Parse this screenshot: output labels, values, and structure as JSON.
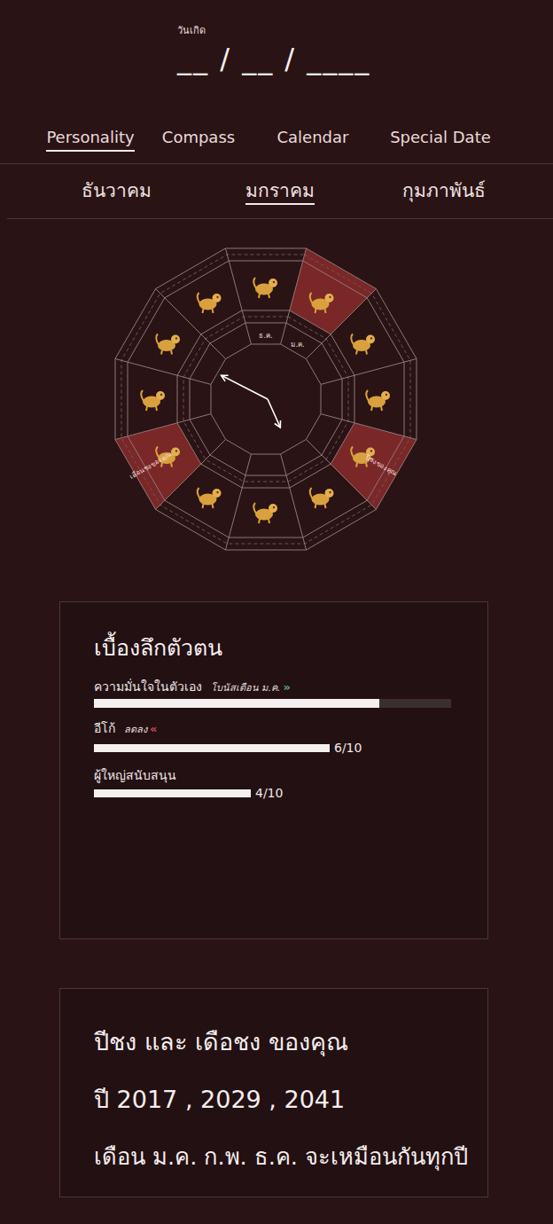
{
  "birthdate": {
    "label": "วันเกิด",
    "placeholder": "__ / __ / ____"
  },
  "tabs": [
    {
      "label": "Personality",
      "selected": true
    },
    {
      "label": "Compass",
      "selected": false
    },
    {
      "label": "Calendar",
      "selected": false
    },
    {
      "label": "Special Date",
      "selected": false
    }
  ],
  "months": [
    {
      "label": "ธันวาคม",
      "selected": false
    },
    {
      "label": "มกราคม",
      "selected": true
    },
    {
      "label": "กุมภาพันธ์",
      "selected": false
    }
  ],
  "wheel": {
    "sectors": [
      {
        "highlighted": false,
        "month": "ธ.ค."
      },
      {
        "highlighted": true,
        "month": "ม.ค."
      },
      {
        "highlighted": false
      },
      {
        "highlighted": false
      },
      {
        "highlighted": true,
        "label": "ปีชงของคุณ"
      },
      {
        "highlighted": false
      },
      {
        "highlighted": false
      },
      {
        "highlighted": false
      },
      {
        "highlighted": true,
        "label": "เดือนชงของคุณ"
      },
      {
        "highlighted": false
      },
      {
        "highlighted": false
      },
      {
        "highlighted": false
      }
    ],
    "pointers": [
      {
        "angle": 298,
        "reach": 0.92
      },
      {
        "angle": 153,
        "reach": 0.58
      }
    ]
  },
  "insights": {
    "title": "เบื้องลึกตัวตน",
    "bars": [
      {
        "kind": "track",
        "label": "ความมั่นใจในตัวเอง",
        "badge": {
          "text": "โบนัสเดือน ม.ค.",
          "icon": "»",
          "color": "#4fae6c"
        },
        "level": 0.8
      },
      {
        "kind": "scored",
        "label": "อีโก้",
        "badge": {
          "text": "ลดลง",
          "icon": "«",
          "color": "#d0455a"
        },
        "level": 0.6,
        "reading": "6/10"
      },
      {
        "kind": "scored",
        "label": "ผู้ใหญ่สนับสนุน",
        "level": 0.4,
        "reading": "4/10"
      }
    ]
  },
  "clash": {
    "title": "ปีชง และ เดือชง ของคุณ",
    "lines": [
      "ปี 2017 , 2029 , 2041",
      "เดือน ม.ค. ก.พ. ธ.ค. จะเหมือนกันทุกปี"
    ]
  }
}
